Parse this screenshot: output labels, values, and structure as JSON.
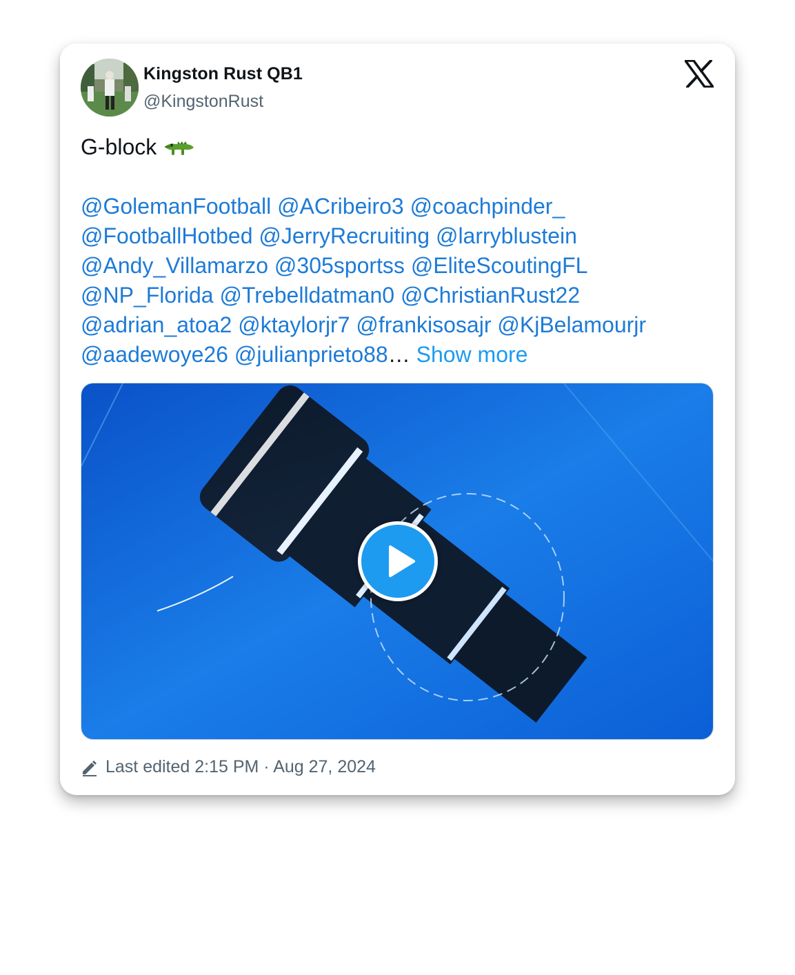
{
  "author": {
    "name": "Kingston Rust QB1",
    "handle": "@KingstonRust"
  },
  "icons": {
    "brand": "x-logo-icon",
    "emoji": "crocodile-emoji-icon",
    "edit": "pencil-icon",
    "play": "play-icon"
  },
  "tweet": {
    "text": "G-block",
    "mention_lines": [
      [
        "@GolemanFootball",
        "@ACribeiro3",
        "@coachpinder_"
      ],
      [
        "@FootballHotbed",
        "@JerryRecruiting",
        "@larryblustein"
      ],
      [
        "@Andy_Villamarzo",
        "@305sportss",
        "@EliteScoutingFL"
      ],
      [
        "@NP_Florida",
        "@Trebelldatman0",
        "@ChristianRust22"
      ],
      [
        "@adrian_atoa2",
        "@ktaylorjr7",
        "@frankisosajr",
        "@KjBelamourjr"
      ],
      [
        "@aadewoye26",
        "@julianprieto88"
      ]
    ],
    "ellipsis": "…",
    "show_more": "Show more"
  },
  "meta": {
    "edited": "Last edited 2:15 PM · Aug 27, 2024"
  },
  "colors": {
    "link": "#1d7bd6",
    "accent": "#1d9bf0",
    "text": "#0f1419",
    "muted": "#536471"
  }
}
